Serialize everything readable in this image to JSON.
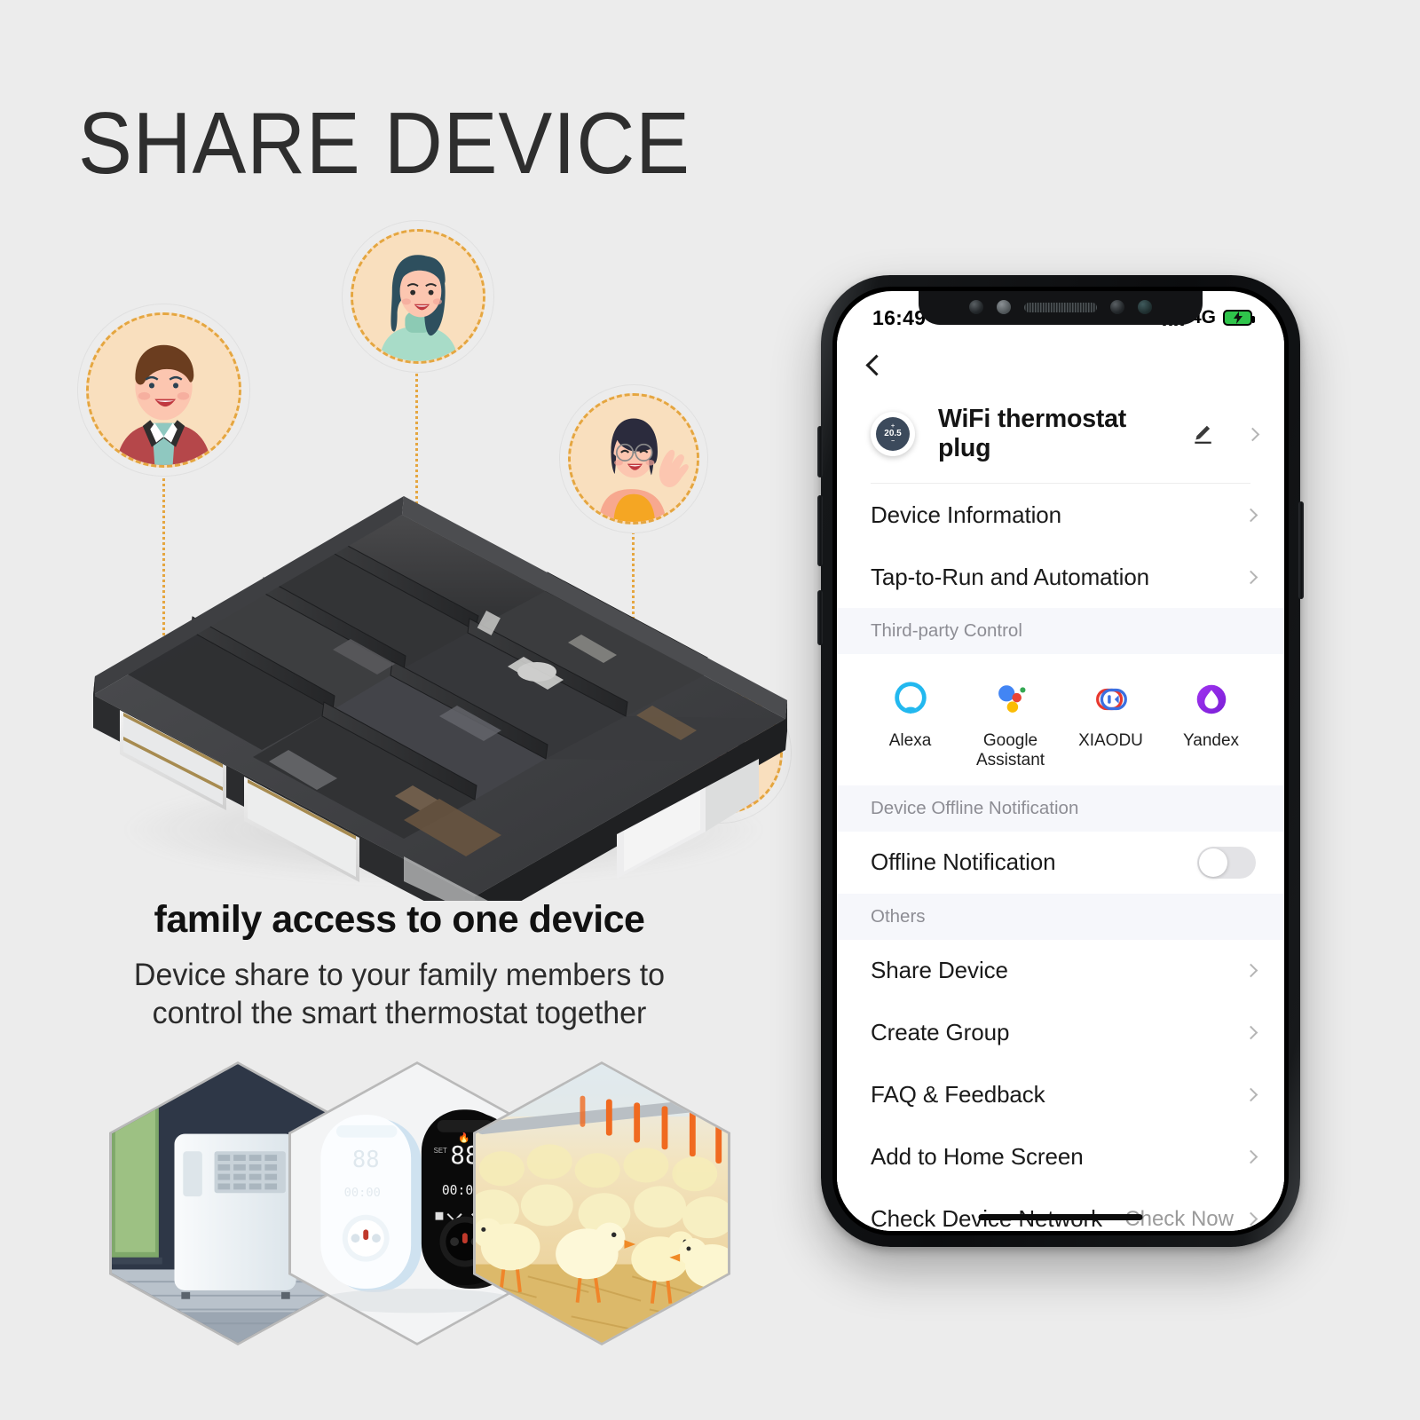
{
  "banner": {
    "headline": "SHARE DEVICE",
    "subheadline": "family access to one device",
    "description_line1": "Device share to your family members to",
    "description_line2": "control the smart thermostat together",
    "accent_color": "#e5a640",
    "background_color": "#ececec"
  },
  "avatars": [
    {
      "name": "avatar-man-red-sweater"
    },
    {
      "name": "avatar-woman-long-hair"
    },
    {
      "name": "avatar-woman-glasses-waving"
    },
    {
      "name": "avatar-man-glasses-turtleneck"
    }
  ],
  "product_tiles": [
    {
      "name": "hex-tile-air-conditioner"
    },
    {
      "name": "hex-tile-smart-plugs"
    },
    {
      "name": "hex-tile-chicks-farm"
    }
  ],
  "phone": {
    "status_bar": {
      "time": "16:49",
      "location_icon": "location-arrow-icon",
      "signal_icon": "signal-bars-icon",
      "network": "4G",
      "battery_icon": "battery-charging-icon"
    },
    "nav": {
      "back_icon": "chevron-left-icon"
    },
    "device": {
      "name": "WiFi thermostat plug",
      "temperature": "20.5",
      "edit_icon": "pencil-icon",
      "chevron": "chevron-right-icon"
    },
    "rows_top": [
      {
        "label": "Device Information"
      },
      {
        "label": "Tap-to-Run and Automation"
      }
    ],
    "third_party": {
      "section_title": "Third-party Control",
      "items": [
        {
          "label": "Alexa",
          "icon": "alexa-icon",
          "color": "#22b8ef"
        },
        {
          "label": "Google\nAssistant",
          "label_l1": "Google",
          "label_l2": "Assistant",
          "icon": "google-assistant-icon"
        },
        {
          "label": "XIAODU",
          "icon": "xiaodu-icon"
        },
        {
          "label": "Yandex",
          "icon": "yandex-icon",
          "color": "#8b33e8"
        }
      ]
    },
    "offline": {
      "section_title": "Device Offline Notification",
      "row_label": "Offline Notification",
      "toggle_state": "off"
    },
    "others": {
      "section_title": "Others",
      "items": [
        {
          "label": "Share Device",
          "value": ""
        },
        {
          "label": "Create Group",
          "value": ""
        },
        {
          "label": "FAQ & Feedback",
          "value": ""
        },
        {
          "label": "Add to Home Screen",
          "value": ""
        },
        {
          "label": "Check Device Network",
          "value": "Check Now"
        }
      ]
    }
  }
}
